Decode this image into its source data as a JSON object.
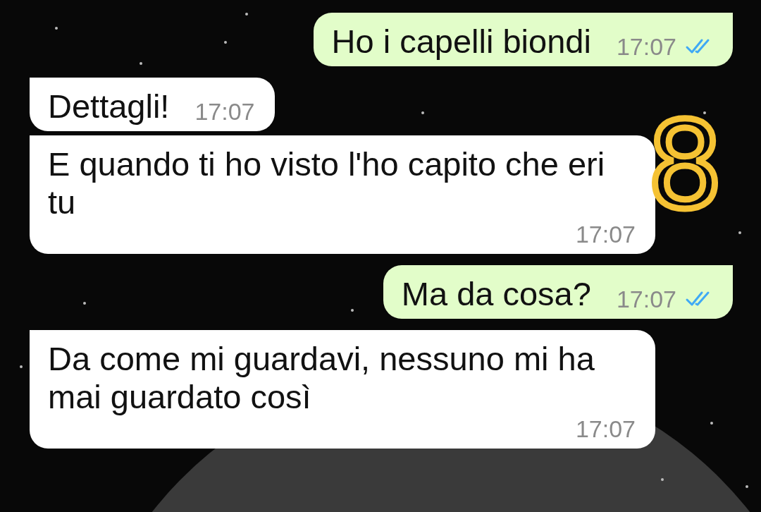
{
  "messages": [
    {
      "kind": "outgoing",
      "text": "Ho i capelli biondi",
      "time": "17:07",
      "read": true
    },
    {
      "kind": "incoming",
      "text": "Dettagli!",
      "time": "17:07"
    },
    {
      "kind": "incoming",
      "text": "E quando ti ho visto l'ho capito che eri tu",
      "time": "17:07"
    },
    {
      "kind": "outgoing",
      "text": "Ma da cosa?",
      "time": "17:07",
      "read": true
    },
    {
      "kind": "incoming",
      "text": "Da come mi guardavi, nessuno mi ha mai guardato così",
      "time": "17:07"
    }
  ],
  "annotation": {
    "text": "8"
  }
}
